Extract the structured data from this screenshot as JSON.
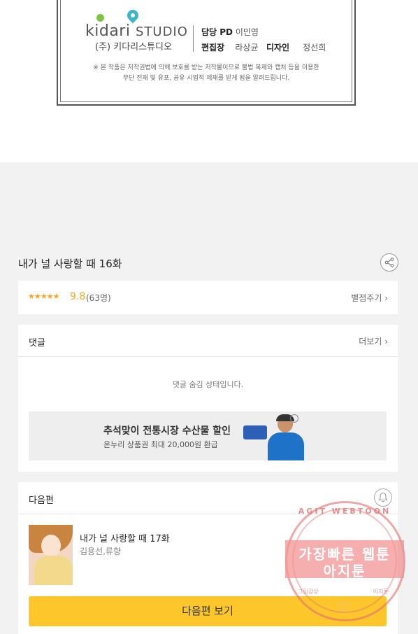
{
  "credits": {
    "logo_word": "kidari",
    "logo_studio": "STUDIO",
    "logo_sub": "(주) 키다리스튜디오",
    "pd_label": "담당 PD",
    "pd_name": "이민영",
    "editor_label": "편집장",
    "editor_name": "라상균",
    "designer_label": "디자인",
    "designer_name": "정선희",
    "notice_line1": "※ 본 작품은 저작권법에 의해 보호를 받는 저작물이므로 불법 복제와 캡처 등을 이용한",
    "notice_line2": "무단 전재 및 유포, 공유 시법적 제재를 받게 됨을 알려드립니다."
  },
  "episode": {
    "title": "내가 널 사랑할 때 16화",
    "share_icon": "share-icon"
  },
  "rating": {
    "stars": "★★★★★",
    "score": "9.8",
    "count": "(63명)",
    "rate_link": "별점주기 ›"
  },
  "comments": {
    "label": "댓글",
    "more": "더보기 ›",
    "hidden_message": "댓글 숨김 상태입니다."
  },
  "ad": {
    "title": "추석맞이 전통시장 수산물 할인",
    "subtitle": "온누리 상품권 최대 20,000원 환급"
  },
  "next": {
    "label": "다음편",
    "bell_icon": "bell-icon",
    "title": "내가 널 사랑할 때 17화",
    "author": "김용선,류향",
    "button": "다음편 보기"
  },
  "watermark": {
    "top_text": "AGIT WEBTOON",
    "line1": "가장빠른 웹툰",
    "line2": "아지툰",
    "bottom_left": "그림감상",
    "bottom_right": "아지툰"
  },
  "colors": {
    "accent_yellow": "#fdc72b",
    "star_orange": "#f5a623",
    "watermark_red": "#e66e6e"
  }
}
